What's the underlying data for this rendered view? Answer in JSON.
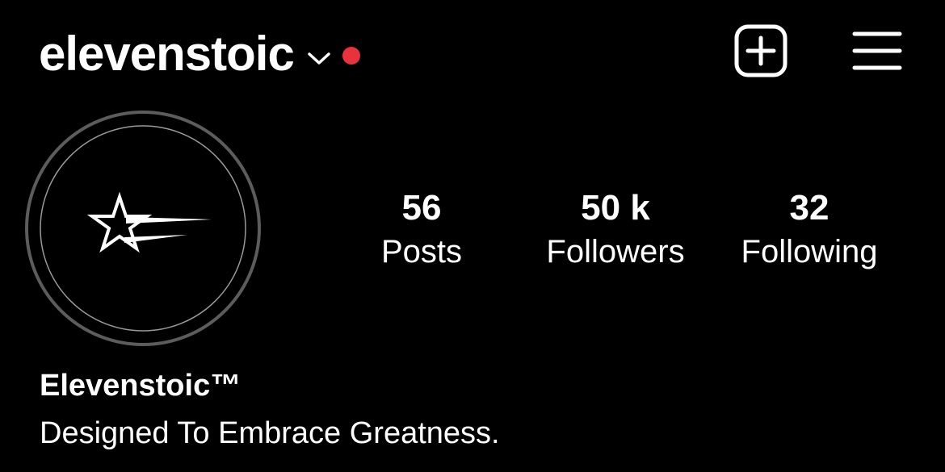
{
  "header": {
    "username": "elevenstoic",
    "account_switch_icon": "chevron-down-icon",
    "notification_dot_color": "#e8323c",
    "new_post_icon": "plus-square-icon",
    "menu_icon": "hamburger-menu-icon"
  },
  "profile": {
    "avatar_logo": "star-logo",
    "display_name": "Elevenstoic™",
    "bio": "Designed To Embrace Greatness."
  },
  "stats": [
    {
      "count": "56",
      "label": "Posts"
    },
    {
      "count": "50 k",
      "label": "Followers"
    },
    {
      "count": "32",
      "label": "Following"
    }
  ],
  "colors": {
    "background": "#000000",
    "text": "#ffffff",
    "avatar_ring": "#5c5c5c"
  }
}
